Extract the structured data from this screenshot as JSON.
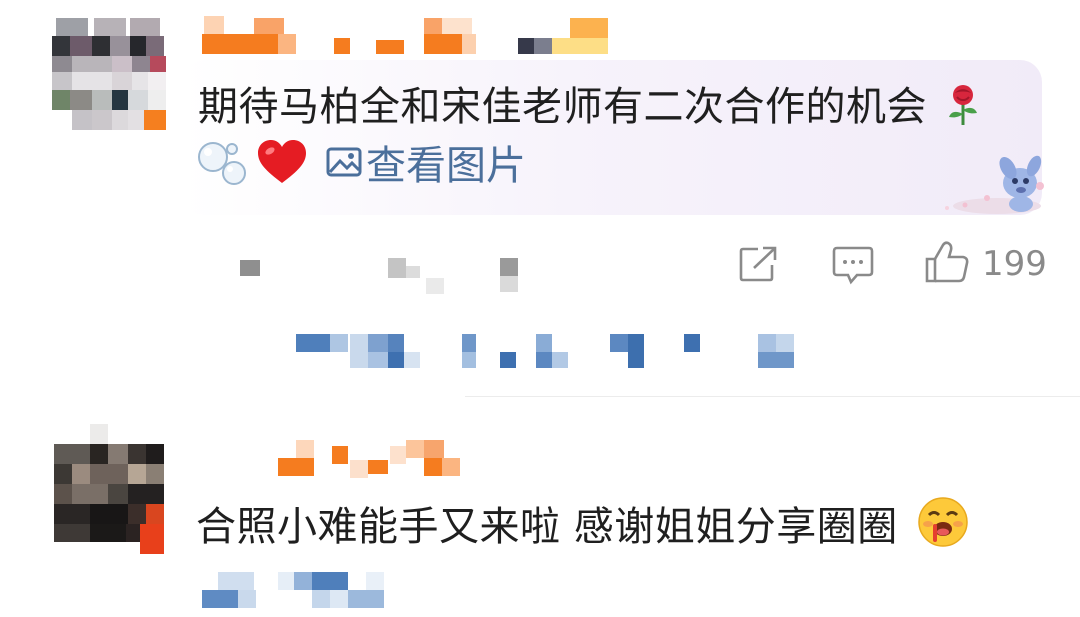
{
  "comments": [
    {
      "text": "期待马柏全和宋佳老师有二次合作的机会",
      "emoji_after_text": "rose-icon",
      "attachments": [
        "bubbles-icon",
        "red-heart-icon"
      ],
      "view_image_label": "查看图片",
      "actions": {
        "share_icon": "share-icon",
        "comment_icon": "comment-icon",
        "like_icon": "thumbs-up-icon",
        "like_count": "199"
      },
      "avatar": "pixelated",
      "username": "pixelated"
    },
    {
      "text": "合照小难能手又来啦 感谢姐姐分享圈圈",
      "emoji_after_text": "drooling-face-icon",
      "avatar": "pixelated",
      "username": "pixelated"
    }
  ],
  "colors": {
    "text": "#1f1f1f",
    "link": "#4b6f9b",
    "meta": "#8a8a8a",
    "bubble": "#f1ebf8",
    "username_orange": "#f57c1f",
    "reply_blue": "#4a79b5"
  }
}
